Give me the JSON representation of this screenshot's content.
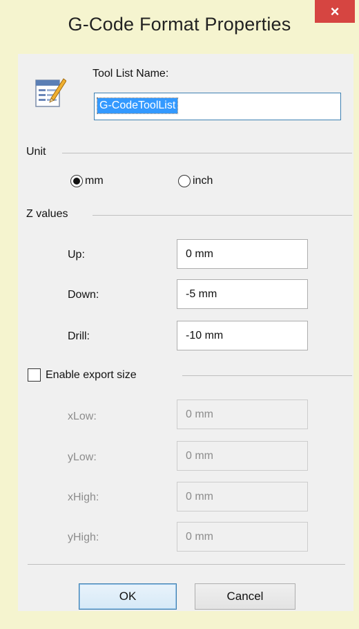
{
  "window": {
    "title": "G-Code Format Properties",
    "close_glyph": "×",
    "accent_colors": {
      "close": "#d64541",
      "selection": "#3399ff"
    }
  },
  "tool_list": {
    "label": "Tool List Name:",
    "value": "G-CodeToolList",
    "icon": "list-edit-icon"
  },
  "unit": {
    "section_label": "Unit",
    "options": [
      {
        "label": "mm",
        "selected": true
      },
      {
        "label": "inch",
        "selected": false
      }
    ]
  },
  "z_values": {
    "section_label": "Z values",
    "fields": [
      {
        "label": "Up:",
        "value": "0 mm"
      },
      {
        "label": "Down:",
        "value": "-5 mm"
      },
      {
        "label": "Drill:",
        "value": "-10 mm"
      }
    ]
  },
  "export_size": {
    "checkbox_label": "Enable export size",
    "checked": false,
    "fields": [
      {
        "label": "xLow:",
        "value": "0 mm"
      },
      {
        "label": "yLow:",
        "value": "0 mm"
      },
      {
        "label": "xHigh:",
        "value": "0 mm"
      },
      {
        "label": "yHigh:",
        "value": "0 mm"
      }
    ]
  },
  "buttons": {
    "ok": "OK",
    "cancel": "Cancel"
  }
}
